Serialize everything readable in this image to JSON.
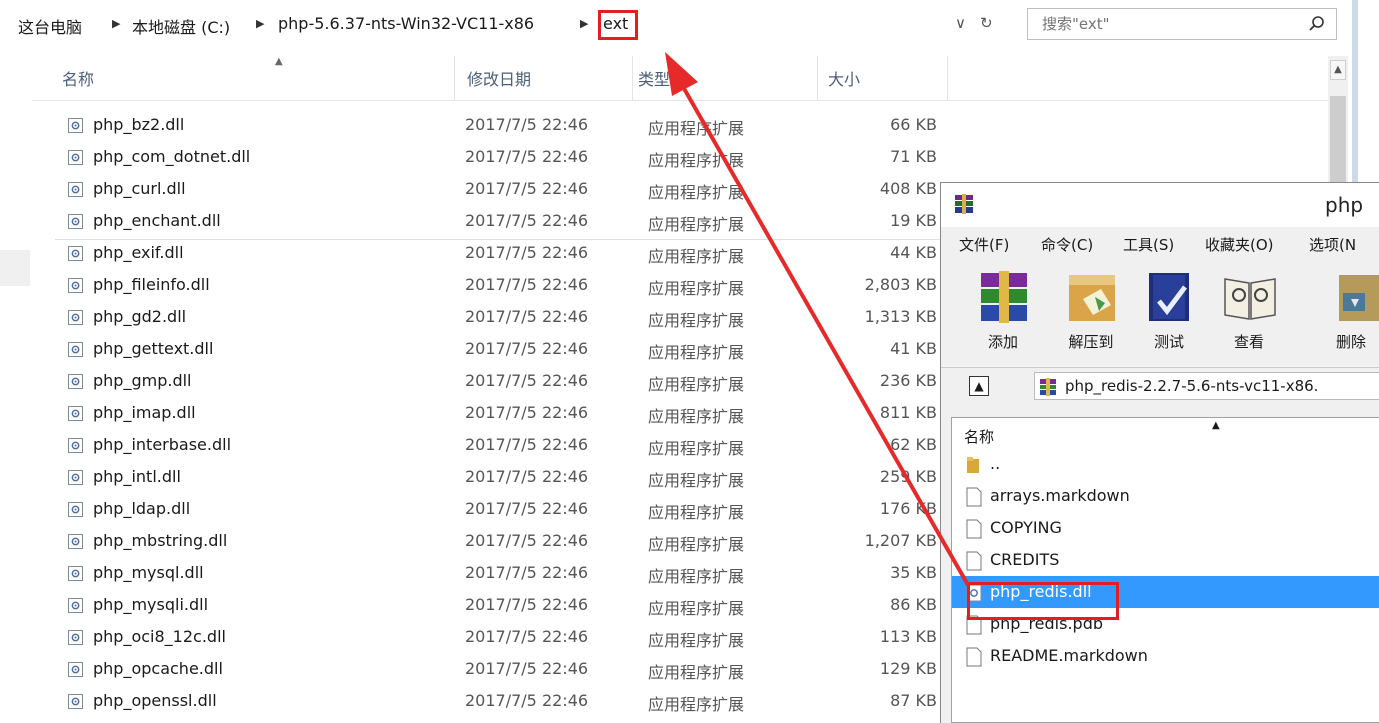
{
  "explorer": {
    "breadcrumb": [
      "这台电脑",
      "本地磁盘 (C:)",
      "php-5.6.37-nts-Win32-VC11-x86",
      "ext"
    ],
    "search_placeholder": "搜索\"ext\"",
    "columns": {
      "name": "名称",
      "date": "修改日期",
      "type": "类型",
      "size": "大小"
    },
    "files": [
      {
        "name": "php_bz2.dll",
        "date": "2017/7/5 22:46",
        "type": "应用程序扩展",
        "size": "66 KB"
      },
      {
        "name": "php_com_dotnet.dll",
        "date": "2017/7/5 22:46",
        "type": "应用程序扩展",
        "size": "71 KB"
      },
      {
        "name": "php_curl.dll",
        "date": "2017/7/5 22:46",
        "type": "应用程序扩展",
        "size": "408 KB"
      },
      {
        "name": "php_enchant.dll",
        "date": "2017/7/5 22:46",
        "type": "应用程序扩展",
        "size": "19 KB"
      },
      {
        "name": "php_exif.dll",
        "date": "2017/7/5 22:46",
        "type": "应用程序扩展",
        "size": "44 KB"
      },
      {
        "name": "php_fileinfo.dll",
        "date": "2017/7/5 22:46",
        "type": "应用程序扩展",
        "size": "2,803 KB"
      },
      {
        "name": "php_gd2.dll",
        "date": "2017/7/5 22:46",
        "type": "应用程序扩展",
        "size": "1,313 KB"
      },
      {
        "name": "php_gettext.dll",
        "date": "2017/7/5 22:46",
        "type": "应用程序扩展",
        "size": "41 KB"
      },
      {
        "name": "php_gmp.dll",
        "date": "2017/7/5 22:46",
        "type": "应用程序扩展",
        "size": "236 KB"
      },
      {
        "name": "php_imap.dll",
        "date": "2017/7/5 22:46",
        "type": "应用程序扩展",
        "size": "811 KB"
      },
      {
        "name": "php_interbase.dll",
        "date": "2017/7/5 22:46",
        "type": "应用程序扩展",
        "size": "62 KB"
      },
      {
        "name": "php_intl.dll",
        "date": "2017/7/5 22:46",
        "type": "应用程序扩展",
        "size": "259 KB"
      },
      {
        "name": "php_ldap.dll",
        "date": "2017/7/5 22:46",
        "type": "应用程序扩展",
        "size": "176 KB"
      },
      {
        "name": "php_mbstring.dll",
        "date": "2017/7/5 22:46",
        "type": "应用程序扩展",
        "size": "1,207 KB"
      },
      {
        "name": "php_mysql.dll",
        "date": "2017/7/5 22:46",
        "type": "应用程序扩展",
        "size": "35 KB"
      },
      {
        "name": "php_mysqli.dll",
        "date": "2017/7/5 22:46",
        "type": "应用程序扩展",
        "size": "86 KB"
      },
      {
        "name": "php_oci8_12c.dll",
        "date": "2017/7/5 22:46",
        "type": "应用程序扩展",
        "size": "113 KB"
      },
      {
        "name": "php_opcache.dll",
        "date": "2017/7/5 22:46",
        "type": "应用程序扩展",
        "size": "129 KB"
      },
      {
        "name": "php_openssl.dll",
        "date": "2017/7/5 22:46",
        "type": "应用程序扩展",
        "size": "87 KB"
      }
    ]
  },
  "winrar": {
    "title": "php",
    "menu": [
      "文件(F)",
      "命令(C)",
      "工具(S)",
      "收藏夹(O)",
      "选项(N"
    ],
    "toolbar": [
      "添加",
      "解压到",
      "测试",
      "查看",
      "删除"
    ],
    "path": "php_redis-2.2.7-5.6-nts-vc11-x86.",
    "list_header": "名称",
    "items": [
      {
        "name": "..",
        "icon": "folder-icon"
      },
      {
        "name": "arrays.markdown",
        "icon": "file-icon"
      },
      {
        "name": "COPYING",
        "icon": "file-icon"
      },
      {
        "name": "CREDITS",
        "icon": "file-icon"
      },
      {
        "name": "php_redis.dll",
        "icon": "dll-icon",
        "selected": true
      },
      {
        "name": "php_redis.pdb",
        "icon": "file-icon"
      },
      {
        "name": "README.markdown",
        "icon": "file-icon"
      }
    ]
  },
  "colors": {
    "highlight": "#e02020",
    "selection": "#3399ff",
    "header_text": "#4c607a"
  }
}
